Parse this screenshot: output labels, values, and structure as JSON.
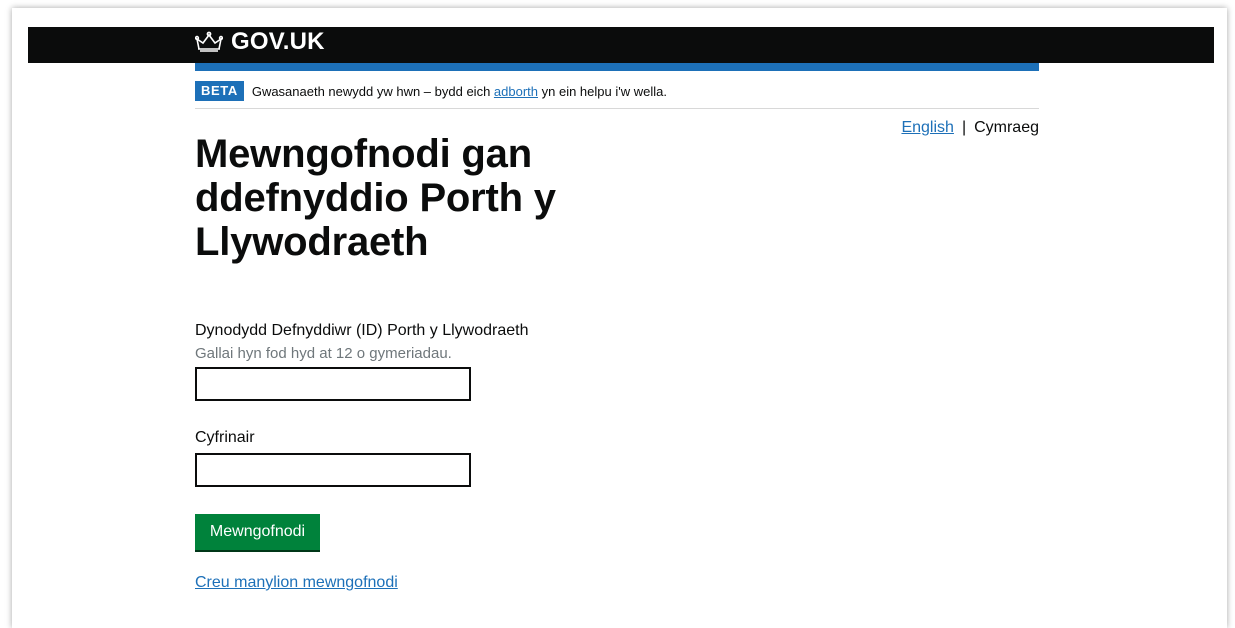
{
  "header": {
    "logo_text": "GOV.UK",
    "logo_icon": "crown-icon"
  },
  "phase_banner": {
    "tag": "BETA",
    "text_before": "Gwasanaeth newydd yw hwn – bydd eich ",
    "link": "adborth",
    "text_after": " yn ein helpu i'w wella."
  },
  "language": {
    "english": "English",
    "separator": "|",
    "welsh": "Cymraeg"
  },
  "page": {
    "title": "Mewngofnodi gan ddefnyddio Porth y Llywodraeth"
  },
  "form": {
    "user_id_label": "Dynodydd Defnyddiwr (ID) Porth y Llywodraeth",
    "user_id_hint": "Gallai hyn fod hyd at 12 o gymeriadau.",
    "user_id_value": "",
    "password_label": "Cyfrinair",
    "password_value": "",
    "submit_label": "Mewngofnodi",
    "create_link": "Creu manylion mewngofnodi"
  },
  "colors": {
    "header_bg": "#0b0c0c",
    "brand_blue": "#1d70b8",
    "button_green": "#00823b",
    "hint_grey": "#6f777b"
  }
}
